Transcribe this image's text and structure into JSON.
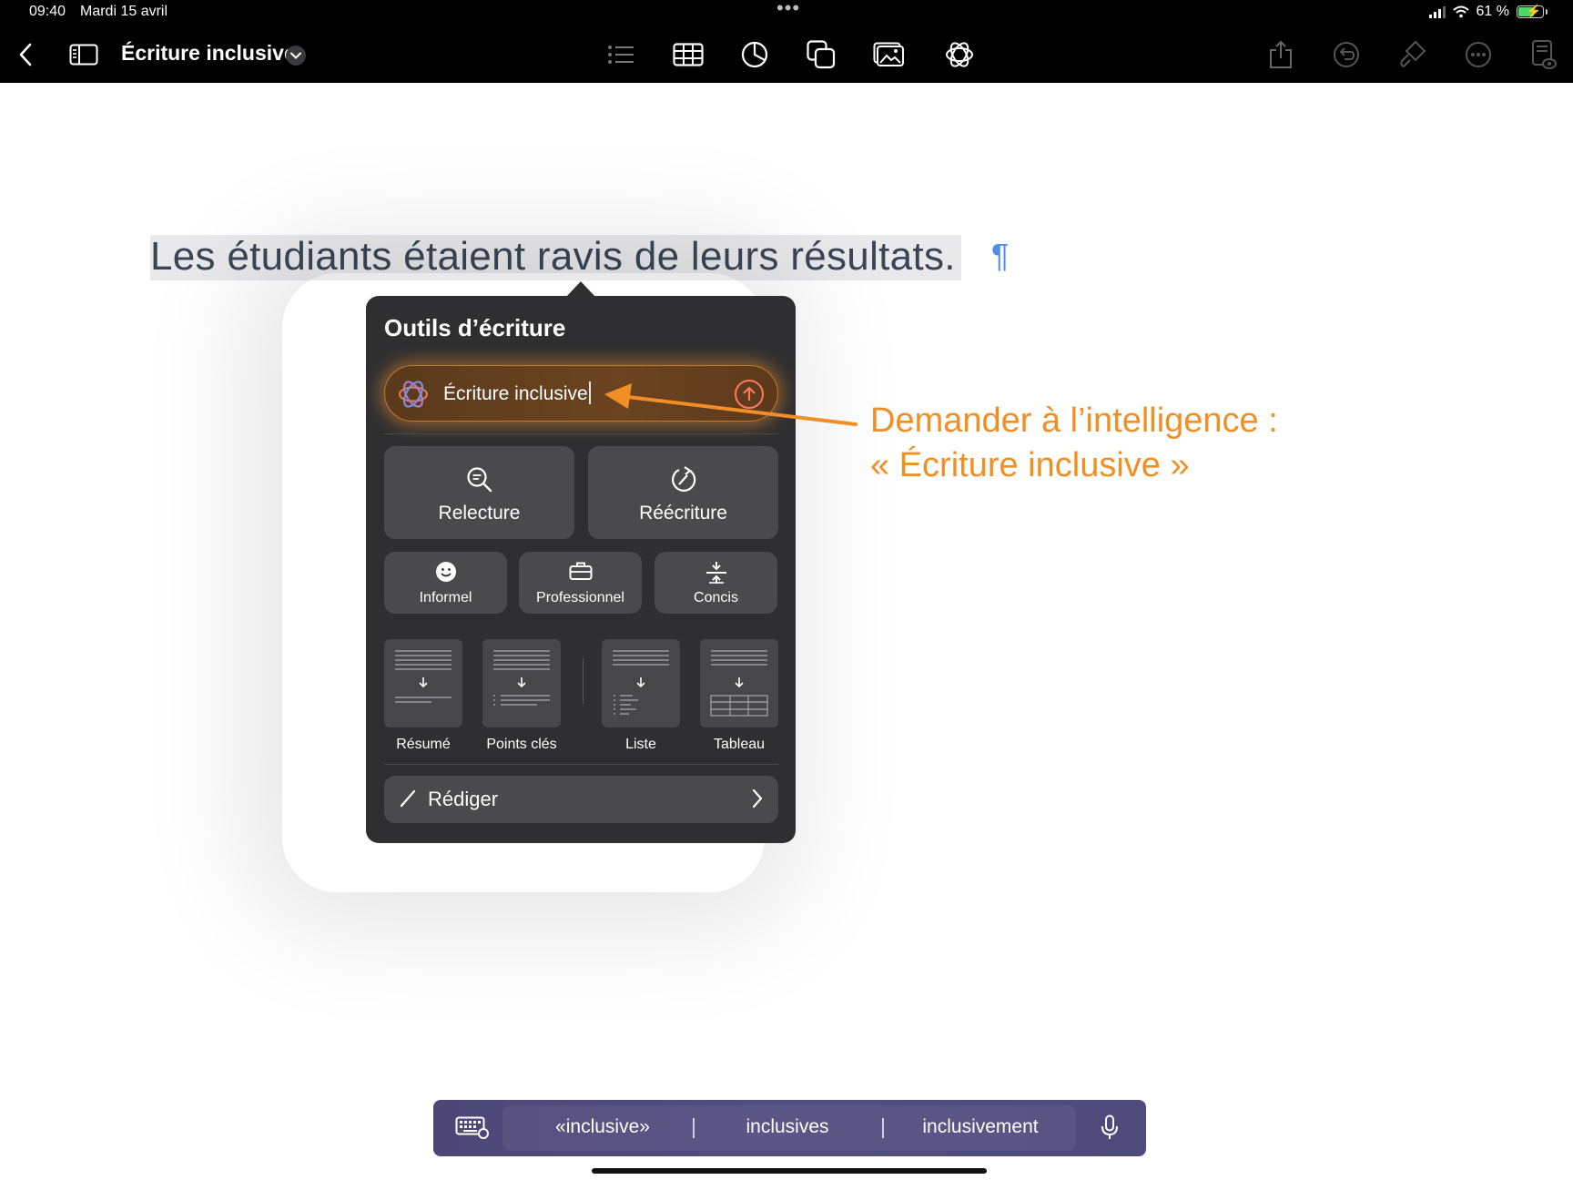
{
  "status_bar": {
    "time": "09:40",
    "date": "Mardi 15 avril",
    "multitask_dots": "•••",
    "battery_pct": "61 %",
    "battery_level": 0.61
  },
  "toolbar": {
    "document_title": "Écriture inclusive",
    "icons": [
      "back-chevron-icon",
      "sidebar-icon",
      "title-menu-chevron-icon",
      "list-icon",
      "table-icon",
      "chart-icon",
      "shapes-icon",
      "media-icon",
      "apple-intelligence-icon",
      "share-icon",
      "undo-icon",
      "format-brush-icon",
      "more-icon",
      "document-view-icon"
    ]
  },
  "document": {
    "text": "Les étudiants étaient ravis de leurs résultats.",
    "paragraph_mark": "¶"
  },
  "writing_tools": {
    "title": "Outils d’écriture",
    "prompt_value": "Écriture inclusive",
    "primary_actions": [
      {
        "label": "Relecture",
        "icon": "proofread-magnifier-icon"
      },
      {
        "label": "Réécriture",
        "icon": "rewrite-circle-arrow-icon"
      }
    ],
    "tone_actions": [
      {
        "label": "Informel",
        "icon": "smiley-icon"
      },
      {
        "label": "Professionnel",
        "icon": "briefcase-icon"
      },
      {
        "label": "Concis",
        "icon": "compress-icon"
      }
    ],
    "transform_actions": [
      {
        "label": "Résumé",
        "icon": "summary-thumbnail-icon"
      },
      {
        "label": "Points clés",
        "icon": "key-points-thumbnail-icon"
      },
      {
        "label": "Liste",
        "icon": "list-thumbnail-icon"
      },
      {
        "label": "Tableau",
        "icon": "table-thumbnail-icon"
      }
    ],
    "compose_label": "Rédiger"
  },
  "annotation": {
    "line1": "Demander à l’intelligence :",
    "line2": "« Écriture inclusive »",
    "color": "#f28f24"
  },
  "keyboard_bar": {
    "suggestions": [
      "«inclusive»",
      "inclusives",
      "inclusivement"
    ]
  },
  "colors": {
    "popover_bg": "#2f2f31",
    "button_bg": "#4a4a4c",
    "glow": "#e88c28",
    "selection": "#e9e9ec",
    "text": "#3a4656",
    "pilcrow": "#4a90e2"
  }
}
